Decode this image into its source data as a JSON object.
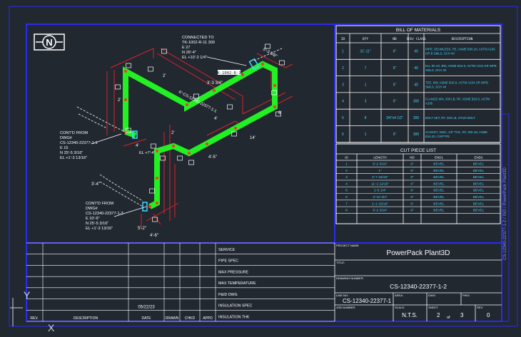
{
  "north_symbol": "N",
  "ucs": {
    "y": "Y",
    "x": "X"
  },
  "bom": {
    "title": "BILL OF MATERIALS",
    "headers": [
      "ID",
      "QTY",
      "ND",
      "SCH/\nCLASS",
      "DESCRIPTION"
    ],
    "rows": [
      {
        "id": "1",
        "qty": "31'-11\"",
        "nd": "6\"",
        "sch": "40",
        "desc": [
          "PIPE, SEAMLESS, PE, ASME B36.10, ASTM A106",
          "GR B SMLS, SCH 40"
        ]
      },
      {
        "id": "2",
        "qty": "7",
        "nd": "6\"",
        "sch": "40",
        "desc": [
          "ELL 90 LR, BW, ASME B16.9, ASTM A234 GR WPB",
          "SMLS, SCH 40"
        ]
      },
      {
        "id": "3",
        "qty": "1",
        "nd": "6\"",
        "sch": "40",
        "desc": [
          "TEE, BW, ASME B16.9, ASTM A234 GR WPB",
          "SMLS, SCH 40"
        ]
      },
      {
        "id": "4",
        "qty": "3",
        "nd": "6\"",
        "sch": "300",
        "desc": [
          "FLANGE WN, 300 LB, RF, ASME B16.5, ASTM",
          "A105"
        ]
      },
      {
        "id": "5",
        "qty": "8",
        "nd": "3/4\"x4 1/2\"",
        "sch": "300",
        "desc": [
          "BOLT SET, RF, 300 LB, STUD BOLT"
        ]
      },
      {
        "id": "6",
        "qty": "1",
        "nd": "6\"",
        "sch": "300",
        "desc": [
          "GASKET, SWG, 1/8\" THK, RF, 300 LB, ASME",
          "B16.20, CS/PTFE"
        ]
      }
    ]
  },
  "cut": {
    "title": "CUT PIECE LIST",
    "headers": [
      "ID",
      "LENGTH",
      "ND",
      "END1",
      "END2"
    ],
    "rows": [
      [
        "1",
        "5'-2 3/16\"",
        "6\"",
        "BEVEL",
        "BEVEL"
      ],
      [
        "2",
        "1\"",
        "6\"",
        "BEVEL",
        "BEVEL"
      ],
      [
        "3",
        "3'-7 15/16\"",
        "6\"",
        "BEVEL",
        "BEVEL"
      ],
      [
        "4",
        "11'-1 11/16\"",
        "6\"",
        "BEVEL",
        "BEVEL"
      ],
      [
        "5",
        "1'-5 1/4\"",
        "6\"",
        "BEVEL",
        "BEVEL"
      ],
      [
        "6",
        "3'-10 3/4\"",
        "6\"",
        "BEVEL",
        "BEVEL"
      ],
      [
        "7",
        "1'-1 15/16\"",
        "6\"",
        "BEVEL",
        "BEVEL"
      ],
      [
        "8",
        "5'-2 3/16\"",
        "6\"",
        "BEVEL",
        "BEVEL"
      ]
    ]
  },
  "title_block": {
    "project_label": "PROJECT NAME:",
    "project_name": "PowerPack Plant3D",
    "title_label": "TITLE:",
    "drawing_label": "DRAWING NUMBER:",
    "drawing_number": "CS-12340-22377-1-2",
    "line_label": "LINE NO:",
    "line_number": "CS-12340-22377-1",
    "area_label": "AREA:",
    "dwg_label": "DWG:",
    "pwg_label": "PWG:",
    "job_label": "JOB NUMBER:",
    "scale_label": "SCALE:",
    "scale": "N.T.S.",
    "sheet_label": "SHEET:",
    "sheet": "2",
    "of": "of",
    "sheets": "3",
    "rev_label": "REV:",
    "rev": "0"
  },
  "spec_labels": [
    "SERVICE",
    "PIPE SPEC",
    "MAX PRESSURE",
    "MAX TEMPERATURE",
    "P&ID DWG",
    "INSULATION SPEC",
    "INSULATION THK"
  ],
  "revision": {
    "headers": [
      "REV.",
      "DESCRIPTION",
      "DATE",
      "DRAWN",
      "CHKD",
      "APPD"
    ],
    "date": "05/22/23"
  },
  "notes": {
    "connected": [
      "CONNECTED TO",
      "TK-1002-R-11 300",
      "E 27",
      "N 26'-4\"",
      "EL +10'-2 1/4\""
    ],
    "contd1": [
      "CONT'D FROM",
      "DWG#",
      "CS-12340-22377-1-1",
      "E 15",
      "N 25'-5 3/16\"",
      "EL +1'-3 13/16\""
    ],
    "contd2": [
      "CONT'D FROM",
      "DWG#",
      "CS-12340-22377-1-3",
      "E 10'-6\"",
      "N 25'-5 3/16\"",
      "EL +1'-3 13/16\""
    ],
    "el_mid": "EL +7'-4\"",
    "pipe_label": "6\"-CS-12340-22377-1-1",
    "tag": "TK-1002-R-11",
    "dims": [
      "2'",
      "2'",
      "5'-3 5/8\"",
      "3'-3 3/4\"",
      "2'",
      "4'",
      "4'-5\"",
      "4'",
      "14'",
      "3'-4\"",
      "8'",
      "5'-2\"",
      "4'-6\""
    ],
    "side_text": "CS-12340-22377-1-2 / ISO / PowerPack Plant3D"
  },
  "colors": {
    "bg": "#212830",
    "border": "#2b2bf0",
    "pipe": "#22f022",
    "dim": "#e0202a",
    "text": "#ffffff",
    "cyan": "#40d8ff"
  }
}
